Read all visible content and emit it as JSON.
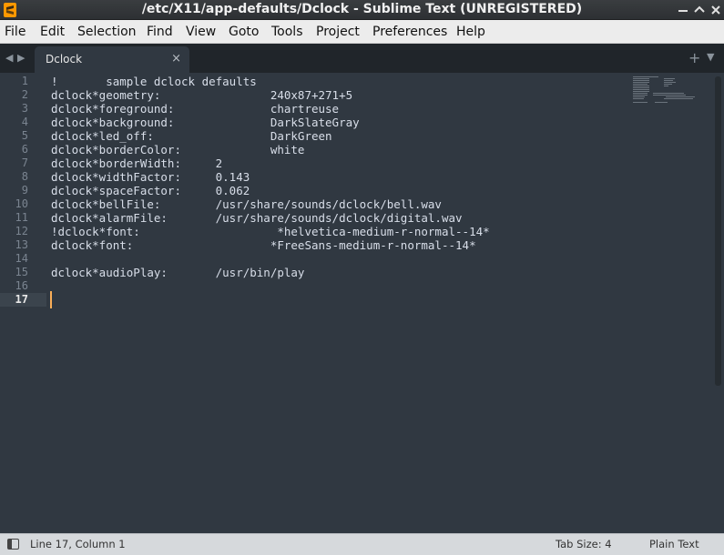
{
  "window": {
    "title": "/etc/X11/app-defaults/Dclock - Sublime Text (UNREGISTERED)",
    "min_icon": "minimize-icon",
    "max_icon": "maximize-icon",
    "close_icon": "close-icon"
  },
  "menu": {
    "items": [
      "File",
      "Edit",
      "Selection",
      "Find",
      "View",
      "Goto",
      "Tools",
      "Project",
      "Preferences",
      "Help"
    ]
  },
  "tabs": [
    {
      "label": "Dclock",
      "close_glyph": "×"
    }
  ],
  "tabbar": {
    "nav_left": "◀",
    "nav_right": "▶",
    "new_tab": "+",
    "dropdown": "▼"
  },
  "editor": {
    "active_line": 17,
    "lines": [
      "!       sample dclock defaults",
      "dclock*geometry:                240x87+271+5",
      "dclock*foreground:              chartreuse",
      "dclock*background:              DarkSlateGray",
      "dclock*led_off:                 DarkGreen",
      "dclock*borderColor:             white",
      "dclock*borderWidth:     2",
      "dclock*widthFactor:     0.143",
      "dclock*spaceFactor:     0.062",
      "dclock*bellFile:        /usr/share/sounds/dclock/bell.wav",
      "dclock*alarmFile:       /usr/share/sounds/dclock/digital.wav",
      "!dclock*font:                    *helvetica-medium-r-normal--14*",
      "dclock*font:                    *FreeSans-medium-r-normal--14*",
      "",
      "dclock*audioPlay:       /usr/bin/play",
      "",
      ""
    ],
    "line_numbers": [
      "1",
      "2",
      "3",
      "4",
      "5",
      "6",
      "7",
      "8",
      "9",
      "10",
      "11",
      "12",
      "13",
      "14",
      "15",
      "16",
      "17"
    ]
  },
  "status": {
    "position": "Line 17, Column 1",
    "tab_size": "Tab Size: 4",
    "syntax": "Plain Text"
  },
  "colors": {
    "editor_bg": "#303841",
    "caret": "#f9ae58",
    "tabbar_bg": "#20252a"
  }
}
